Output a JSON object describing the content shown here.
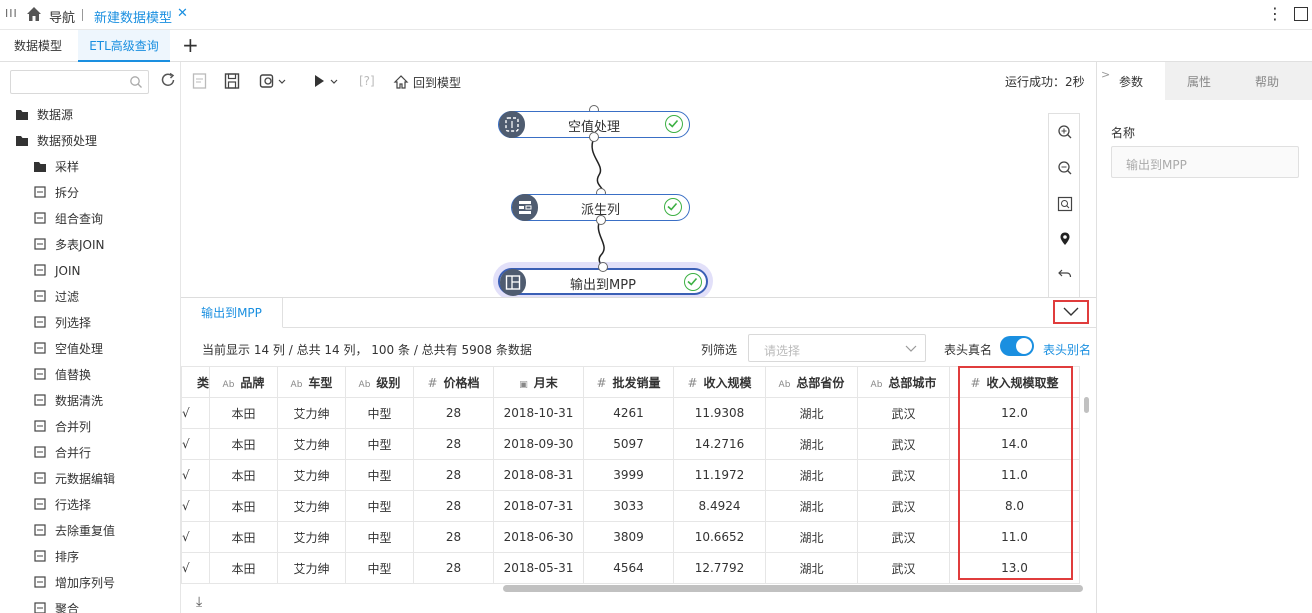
{
  "topbar": {
    "menu_icon": "menu-icon",
    "nav_label": "导航",
    "tab_name": "新建数据模型",
    "close_glyph": "✕"
  },
  "tabs": {
    "model": "数据模型",
    "etl": "ETL高级查询",
    "add": "+"
  },
  "sidebar": {
    "search_placeholder": "",
    "items": [
      {
        "label": "数据源",
        "icon": "folder-icon",
        "level": 0
      },
      {
        "label": "数据预处理",
        "icon": "folder-icon",
        "level": 0
      },
      {
        "label": "采样",
        "icon": "folder-icon",
        "level": 1
      },
      {
        "label": "拆分",
        "icon": "split-icon",
        "level": 1
      },
      {
        "label": "组合查询",
        "icon": "combine-query-icon",
        "level": 1
      },
      {
        "label": "多表JOIN",
        "icon": "multi-join-icon",
        "level": 1
      },
      {
        "label": "JOIN",
        "icon": "join-icon",
        "level": 1
      },
      {
        "label": "过滤",
        "icon": "filter-icon",
        "level": 1
      },
      {
        "label": "列选择",
        "icon": "column-select-icon",
        "level": 1
      },
      {
        "label": "空值处理",
        "icon": "null-handling-icon",
        "level": 1
      },
      {
        "label": "值替换",
        "icon": "value-replace-icon",
        "level": 1
      },
      {
        "label": "数据清洗",
        "icon": "data-clean-icon",
        "level": 1
      },
      {
        "label": "合并列",
        "icon": "merge-columns-icon",
        "level": 1
      },
      {
        "label": "合并行",
        "icon": "merge-rows-icon",
        "level": 1
      },
      {
        "label": "元数据编辑",
        "icon": "metadata-edit-icon",
        "level": 1
      },
      {
        "label": "行选择",
        "icon": "row-select-icon",
        "level": 1
      },
      {
        "label": "去除重复值",
        "icon": "dedupe-icon",
        "level": 1
      },
      {
        "label": "排序",
        "icon": "sort-icon",
        "level": 1
      },
      {
        "label": "增加序列号",
        "icon": "add-serial-icon",
        "level": 1
      },
      {
        "label": "聚合",
        "icon": "aggregate-icon",
        "level": 1
      }
    ]
  },
  "toolbar": {
    "back_label": "回到模型",
    "bracket_label": "[?]",
    "run_status": "运行成功：2秒"
  },
  "canvas": {
    "nodes": [
      {
        "label": "空值处理",
        "icon": "null-handling-icon"
      },
      {
        "label": "派生列",
        "icon": "derived-column-icon"
      },
      {
        "label": "输出到MPP",
        "icon": "output-mpp-icon"
      }
    ]
  },
  "bottom": {
    "tab_label": "输出到MPP",
    "summary": "当前显示 14 列 / 总共 14 列， 100 条 / 总共有 5908 条数据",
    "col_filter_label": "列筛选",
    "col_filter_placeholder": "请选择",
    "realname_label": "表头真名",
    "alias_label": "表头别名",
    "toggle_on": true
  },
  "table": {
    "columns": [
      {
        "type": "",
        "name": "类"
      },
      {
        "type": "Ab",
        "name": "品牌"
      },
      {
        "type": "Ab",
        "name": "车型"
      },
      {
        "type": "Ab",
        "name": "级别"
      },
      {
        "type": "#",
        "name": "价格档"
      },
      {
        "type": "date",
        "name": "月末"
      },
      {
        "type": "#",
        "name": "批发销量"
      },
      {
        "type": "#",
        "name": "收入规模"
      },
      {
        "type": "Ab",
        "name": "总部省份"
      },
      {
        "type": "Ab",
        "name": "总部城市"
      },
      {
        "type": "#",
        "name": "收入规模取整"
      }
    ],
    "rows": [
      [
        "√",
        "本田",
        "艾力绅",
        "中型",
        "28",
        "2018-10-31",
        "4261",
        "11.9308",
        "湖北",
        "武汉",
        "12.0"
      ],
      [
        "√",
        "本田",
        "艾力绅",
        "中型",
        "28",
        "2018-09-30",
        "5097",
        "14.2716",
        "湖北",
        "武汉",
        "14.0"
      ],
      [
        "√",
        "本田",
        "艾力绅",
        "中型",
        "28",
        "2018-08-31",
        "3999",
        "11.1972",
        "湖北",
        "武汉",
        "11.0"
      ],
      [
        "√",
        "本田",
        "艾力绅",
        "中型",
        "28",
        "2018-07-31",
        "3033",
        "8.4924",
        "湖北",
        "武汉",
        "8.0"
      ],
      [
        "√",
        "本田",
        "艾力绅",
        "中型",
        "28",
        "2018-06-30",
        "3809",
        "10.6652",
        "湖北",
        "武汉",
        "11.0"
      ],
      [
        "√",
        "本田",
        "艾力绅",
        "中型",
        "28",
        "2018-05-31",
        "4564",
        "12.7792",
        "湖北",
        "武汉",
        "13.0"
      ]
    ]
  },
  "rpanel": {
    "tabs": [
      "参数",
      "属性",
      "帮助"
    ],
    "name_label": "名称",
    "name_value": "输出到MPP"
  },
  "colors": {
    "accent": "#1a8fe0",
    "highlight": "#e03c3c",
    "success": "#3cb043"
  }
}
